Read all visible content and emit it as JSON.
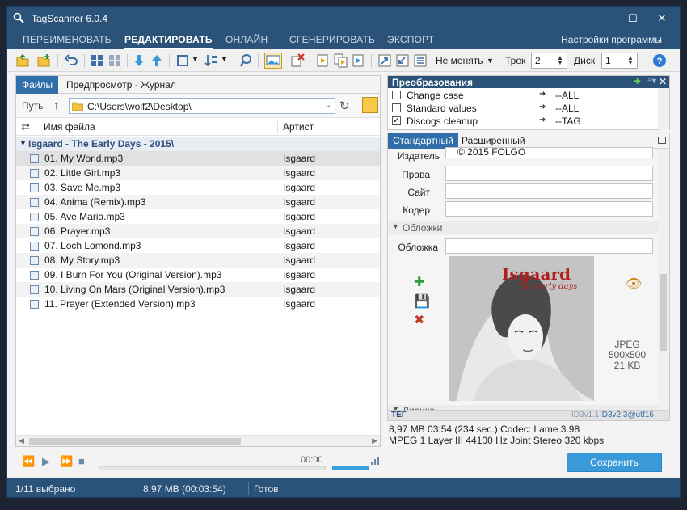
{
  "window": {
    "title": "TagScanner 6.0.4"
  },
  "nav": {
    "tabs": [
      "ПЕРЕИМЕНОВАТЬ",
      "РЕДАКТИРОВАТЬ",
      "ОНЛАЙН",
      "СГЕНЕРИРОВАТЬ",
      "ЭКСПОРТ"
    ],
    "active": "РЕДАКТИРОВАТЬ",
    "settings": "Настройки программы"
  },
  "toolbar": {
    "mode": "Не менять",
    "track_label": "Трек",
    "track_value": "2",
    "disc_label": "Диск",
    "disc_value": "1"
  },
  "left": {
    "tabs": [
      "Файлы",
      "Предпросмотр - Журнал"
    ],
    "path_label": "Путь",
    "path": "C:\\Users\\wolf2\\Desktop\\",
    "col_name": "Имя файла",
    "col_artist": "Артист",
    "group": "Isgaard - The Early Days - 2015\\",
    "files": [
      {
        "name": "01. My World.mp3",
        "artist": "Isgaard"
      },
      {
        "name": "02. Little Girl.mp3",
        "artist": "Isgaard"
      },
      {
        "name": "03. Save Me.mp3",
        "artist": "Isgaard"
      },
      {
        "name": "04. Anima (Remix).mp3",
        "artist": "Isgaard"
      },
      {
        "name": "05. Ave Maria.mp3",
        "artist": "Isgaard"
      },
      {
        "name": "06. Prayer.mp3",
        "artist": "Isgaard"
      },
      {
        "name": "07. Loch Lomond.mp3",
        "artist": "Isgaard"
      },
      {
        "name": "08. My Story.mp3",
        "artist": "Isgaard"
      },
      {
        "name": "09. I Burn For You (Original Version).mp3",
        "artist": "Isgaard"
      },
      {
        "name": "10. Living On Mars (Original Version).mp3",
        "artist": "Isgaard"
      },
      {
        "name": "11. Prayer (Extended Version).mp3",
        "artist": "Isgaard"
      }
    ]
  },
  "player": {
    "time": "00:00"
  },
  "transforms": {
    "title": "Преобразования",
    "items": [
      {
        "name": "Change case",
        "target": "--ALL",
        "checked": false
      },
      {
        "name": "Standard values",
        "target": "--ALL",
        "checked": false
      },
      {
        "name": "Discogs cleanup",
        "target": "--TAG",
        "checked": true
      }
    ]
  },
  "editor": {
    "tabs": [
      "Стандартный",
      "Расширенный"
    ],
    "publisher_label": "Издатель",
    "publisher_value": "© 2015 FOLGO",
    "rights_label": "Права",
    "site_label": "Сайт",
    "encoder_label": "Кодер",
    "covers_section": "Обложки",
    "cover_label": "Обложка",
    "cover_title": "Isgaard",
    "cover_subtitle": "the early days",
    "cover_format": "JPEG",
    "cover_dims": "500x500",
    "cover_size": "21 KB",
    "lyrics_section": "Лирика",
    "tag_label": "ТЕГ",
    "tag_v1": "ID3v1.1",
    "tag_v2": "ID3v2.3@utf16"
  },
  "audio": {
    "line1": "8,97 MB  03:54 (234 sec.)  Codec: Lame 3.98",
    "line2": "MPEG 1 Layer III  44100 Hz  Joint Stereo  320 kbps"
  },
  "save_label": "Сохранить",
  "status": {
    "selected": "1/11 выбрано",
    "size": "8,97 MB (00:03:54)",
    "state": "Готов"
  }
}
